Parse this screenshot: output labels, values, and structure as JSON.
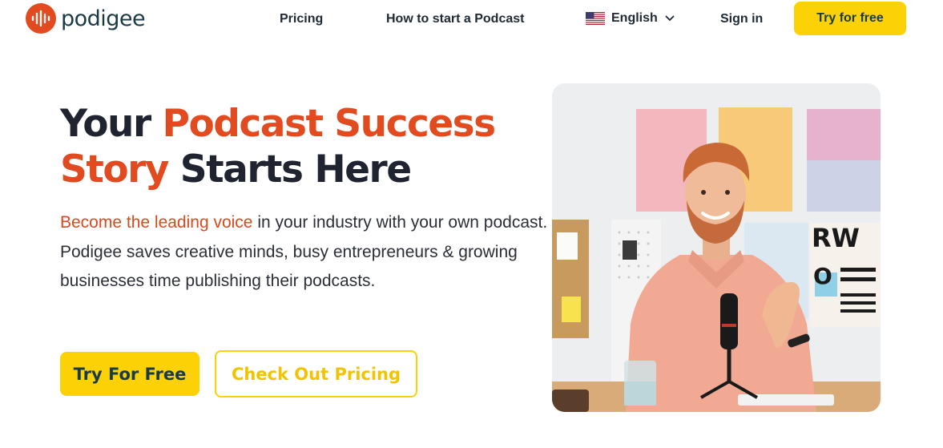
{
  "header": {
    "logo_text": "podigee",
    "nav": {
      "pricing": "Pricing",
      "how_to": "How to start a Podcast",
      "sign_in": "Sign in"
    },
    "language": {
      "selected": "English",
      "flag_icon": "us-flag-icon"
    },
    "cta_label": "Try for free"
  },
  "hero": {
    "title": {
      "part1": "Your ",
      "accent": "Podcast Success Story",
      "part2": " Starts Here"
    },
    "paragraph": {
      "accent": "Become the leading voice",
      "rest1": " in your industry with your own podcast.",
      "line2": "Podigee saves creative minds, busy entrepreneurs & growing businesses time publishing their podcasts."
    },
    "primary_button": "Try For Free",
    "secondary_button": "Check Out Pricing"
  },
  "colors": {
    "accent": "#e24a1f",
    "button_yellow": "#fcd206",
    "brand_dark": "#1a3a44"
  }
}
